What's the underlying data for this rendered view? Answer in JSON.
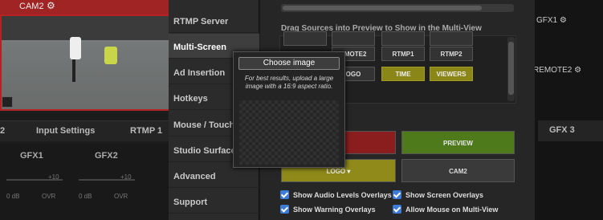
{
  "background": {
    "camera_preview": {
      "label": "CAM2",
      "gear_icon": "gear-icon",
      "accent": "#b62222"
    },
    "tabs": [
      "2",
      "Input Settings",
      "RTMP 1"
    ],
    "mixer_channels": [
      {
        "name": "GFX1",
        "db_left": "0 dB",
        "db_right": "OVR",
        "scale": "+10"
      },
      {
        "name": "GFX2",
        "db_left": "0 dB",
        "db_right": "OVR",
        "scale": "+10"
      }
    ],
    "right_labels": {
      "gfx1": "GFX1",
      "remote2": "REMOTE2",
      "gfx3": "GFX 3"
    }
  },
  "nav": {
    "items": [
      {
        "label": "RTMP Server",
        "active": false
      },
      {
        "label": "Multi-Screen",
        "active": true
      },
      {
        "label": "Ad Insertion",
        "active": false
      },
      {
        "label": "Hotkeys",
        "active": false
      },
      {
        "label": "Mouse / Touch",
        "active": false
      },
      {
        "label": "Studio Surface",
        "active": false
      },
      {
        "label": "Advanced",
        "active": false
      },
      {
        "label": "Support",
        "active": false
      }
    ]
  },
  "content": {
    "drag_label": "Drag Sources into Preview to Show in the Multi-View",
    "sources": [
      "EMOTE2",
      "RTMP1",
      "RTMP2",
      "OGO",
      "TIME",
      "VIEWERS"
    ],
    "big_buttons": {
      "cam": "AM",
      "preview": "PREVIEW",
      "logo": "LOGO ▾",
      "cam2": "CAM2"
    },
    "checkboxes": [
      {
        "label": "Show Audio Levels Overlays",
        "checked": true
      },
      {
        "label": "Show Screen Overlays",
        "checked": true
      },
      {
        "label": "Show Warning Overlays",
        "checked": true
      },
      {
        "label": "Allow Mouse on Multi-View",
        "checked": true
      }
    ]
  },
  "popup": {
    "button": "Choose image",
    "note": "For best results, upload a large image with a 16:9 aspect ratio."
  },
  "colors": {
    "checkbox": "#3d7bd6",
    "preview_green": "#4f7a1c",
    "cam_red": "#8a1e1e",
    "logo_yellow": "#8f8a1a"
  }
}
